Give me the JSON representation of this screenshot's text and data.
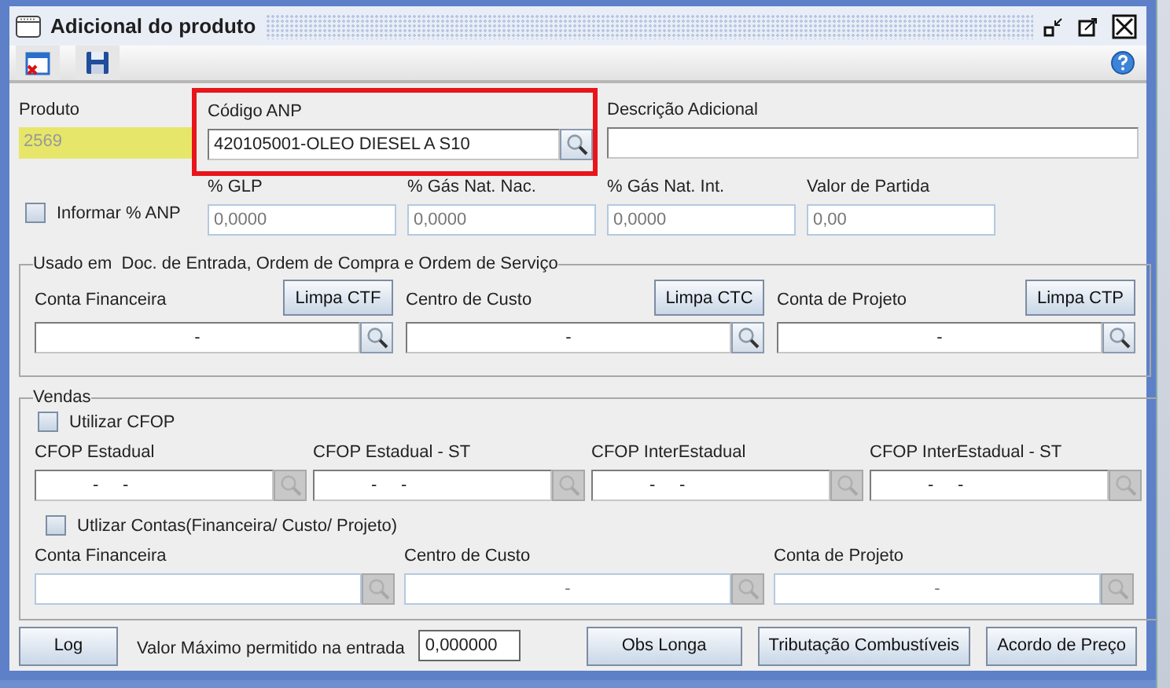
{
  "window": {
    "title": "Adicional do produto"
  },
  "produto": {
    "label": "Produto",
    "value": "2569"
  },
  "codigo_anp": {
    "label": "Código ANP",
    "value": "420105001-OLEO DIESEL A S10",
    "highlighted": true
  },
  "descricao_adicional": {
    "label": "Descrição Adicional"
  },
  "informar_anp": {
    "label": "Informar % ANP",
    "checked": false
  },
  "percent_fields": [
    {
      "label": "% GLP",
      "value": "0,0000"
    },
    {
      "label": "% Gás Nat. Nac.",
      "value": "0,0000"
    },
    {
      "label": "% Gás Nat. Int.",
      "value": "0,0000"
    },
    {
      "label": "Valor de Partida",
      "value": "0,00"
    }
  ],
  "usado_em": {
    "legend": "Usado em  Doc. de Entrada, Ordem de Compra e Ordem de Serviço",
    "accounts": [
      {
        "label": "Conta Financeira",
        "button": "Limpa CTF",
        "value": "-"
      },
      {
        "label": "Centro de Custo",
        "button": "Limpa CTC",
        "value": "-"
      },
      {
        "label": "Conta de Projeto",
        "button": "Limpa CTP",
        "value": "-"
      }
    ]
  },
  "vendas": {
    "legend": "Vendas",
    "utilizar_cfop": {
      "label": "Utilizar CFOP",
      "checked": false
    },
    "cfop_fields": [
      {
        "label": "CFOP Estadual",
        "value": "-     -",
        "disabled": true
      },
      {
        "label": "CFOP Estadual - ST",
        "value": "-     -",
        "disabled": true
      },
      {
        "label": "CFOP InterEstadual",
        "value": "-     -",
        "disabled": true
      },
      {
        "label": "CFOP InterEstadual - ST",
        "value": "-     -",
        "disabled": true
      }
    ],
    "utilizar_contas": {
      "label": "Utlizar Contas(Financeira/ Custo/ Projeto)",
      "checked": false
    },
    "accounts": [
      {
        "label": "Conta Financeira",
        "disabled": true
      },
      {
        "label": "Centro de Custo",
        "value": "-",
        "disabled": true
      },
      {
        "label": "Conta de Projeto",
        "value": "-",
        "disabled": true
      }
    ]
  },
  "footer": {
    "log_button": "Log",
    "max_label": "Valor Máximo permitido na entrada",
    "max_value": "0,000000",
    "buttons": [
      "Obs Longa",
      "Tributação Combustíveis",
      "Acordo de Preço"
    ]
  }
}
